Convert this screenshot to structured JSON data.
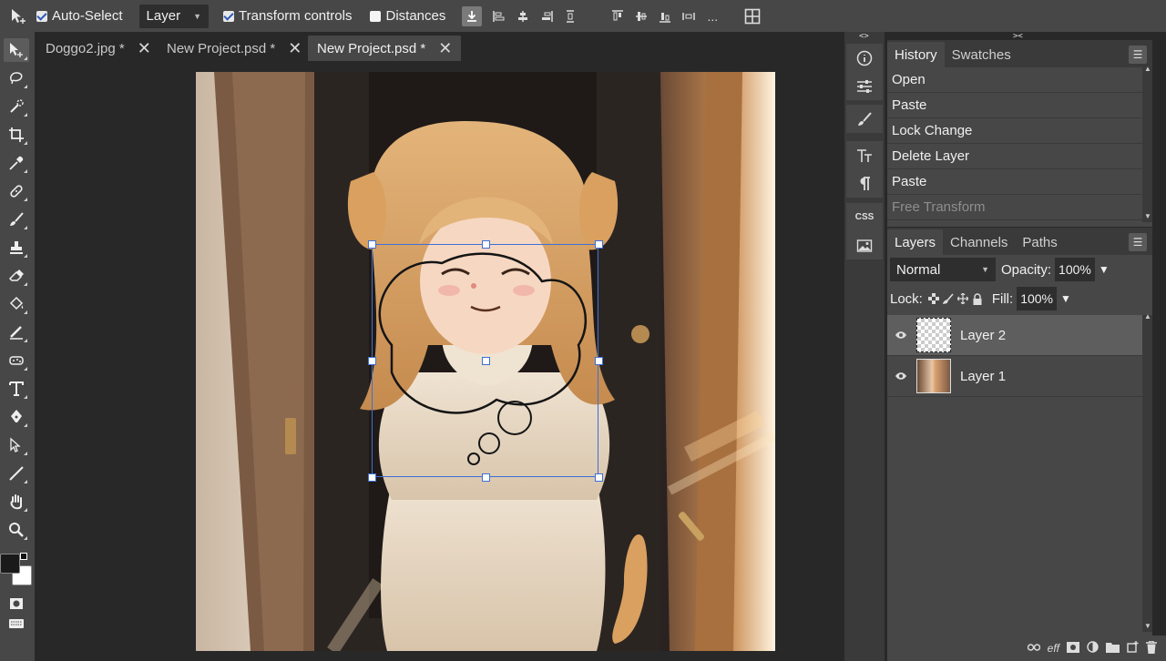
{
  "toolbar": {
    "auto_select_label": "Auto-Select",
    "auto_select_checked": true,
    "layer_select_value": "Layer",
    "transform_controls_label": "Transform controls",
    "transform_controls_checked": true,
    "distances_label": "Distances",
    "distances_checked": false,
    "more_label": "..."
  },
  "tabs": [
    {
      "label": "Doggo2.jpg *",
      "active": false
    },
    {
      "label": "New Project.psd *",
      "active": false
    },
    {
      "label": "New Project.psd *",
      "active": true
    }
  ],
  "history": {
    "tabs": [
      "History",
      "Swatches"
    ],
    "items": [
      "Open",
      "Paste",
      "Lock Change",
      "Delete Layer",
      "Paste",
      "Free Transform"
    ]
  },
  "layers": {
    "tabs": [
      "Layers",
      "Channels",
      "Paths"
    ],
    "blend_mode": "Normal",
    "opacity_label": "Opacity:",
    "opacity_value": "100%",
    "lock_label": "Lock:",
    "fill_label": "Fill:",
    "fill_value": "100%",
    "items": [
      {
        "name": "Layer 2",
        "selected": true
      },
      {
        "name": "Layer 1",
        "selected": false
      }
    ]
  },
  "midstrip": {
    "css_label": "CSS",
    "collapse_left": "<>",
    "collapse_right": "><"
  },
  "bottom": {
    "eff_label": "eff"
  },
  "colors": {
    "foreground": "#1a1a1a",
    "background": "#ffffff",
    "selection_accent": "#3d6fd6"
  }
}
